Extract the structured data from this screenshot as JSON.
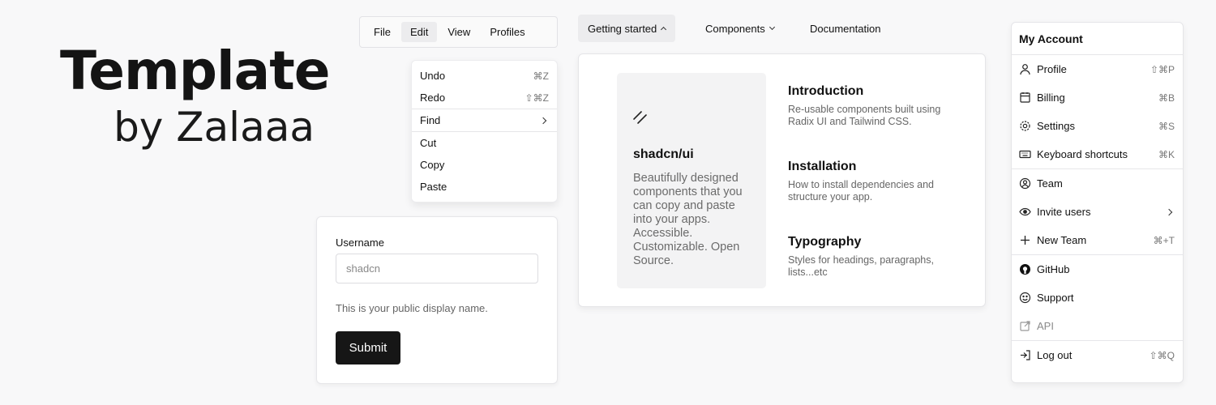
{
  "hero": {
    "title": "Template",
    "subtitle": "by Zalaaa"
  },
  "menubar": {
    "items": [
      {
        "label": "File"
      },
      {
        "label": "Edit",
        "active": true
      },
      {
        "label": "View"
      },
      {
        "label": "Profiles"
      }
    ]
  },
  "edit_menu": {
    "items": [
      {
        "label": "Undo",
        "shortcut": "⌘Z"
      },
      {
        "label": "Redo",
        "shortcut": "⇧⌘Z"
      },
      {
        "label": "Find",
        "submenu": true
      },
      {
        "label": "Cut"
      },
      {
        "label": "Copy"
      },
      {
        "label": "Paste"
      }
    ]
  },
  "form": {
    "label": "Username",
    "placeholder": "shadcn",
    "help": "This is your public display name.",
    "submit": "Submit"
  },
  "nav": {
    "triggers": [
      {
        "label": "Getting started",
        "open": true
      },
      {
        "label": "Components"
      },
      {
        "label": "Documentation"
      }
    ],
    "feature": {
      "title": "shadcn/ui",
      "description": "Beautifully designed components that you can copy and paste into your apps. Accessible. Customizable. Open Source."
    },
    "links": [
      {
        "title": "Introduction",
        "description": "Re-usable components built using Radix UI and Tailwind CSS."
      },
      {
        "title": "Installation",
        "description": "How to install dependencies and structure your app."
      },
      {
        "title": "Typography",
        "description": "Styles for headings, paragraphs, lists...etc"
      }
    ]
  },
  "account": {
    "heading": "My Account",
    "items": [
      {
        "label": "Profile",
        "shortcut": "⇧⌘P",
        "icon": "user-icon"
      },
      {
        "label": "Billing",
        "shortcut": "⌘B",
        "icon": "credit-card-icon"
      },
      {
        "label": "Settings",
        "shortcut": "⌘S",
        "icon": "gear-icon"
      },
      {
        "label": "Keyboard shortcuts",
        "shortcut": "⌘K",
        "icon": "keyboard-icon"
      },
      {
        "label": "Team",
        "icon": "team-icon"
      },
      {
        "label": "Invite users",
        "icon": "eye-icon",
        "submenu": true
      },
      {
        "label": "New Team",
        "shortcut": "⌘+T",
        "icon": "plus-icon"
      },
      {
        "label": "GitHub",
        "icon": "github-icon"
      },
      {
        "label": "Support",
        "icon": "smiley-icon"
      },
      {
        "label": "API",
        "icon": "external-link-icon",
        "disabled": true
      },
      {
        "label": "Log out",
        "shortcut": "⇧⌘Q",
        "icon": "logout-icon"
      }
    ]
  },
  "colors": {
    "background": "#f8f8f9",
    "primary_button": "#161616",
    "muted_text": "#6b6b6b"
  }
}
